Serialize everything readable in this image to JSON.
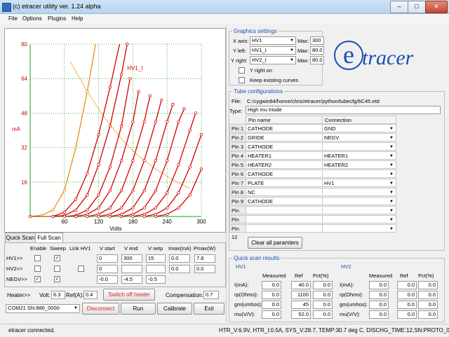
{
  "window": {
    "title": "(c) etracer utility ver. 1.24 alpha",
    "min": "–",
    "max": "□",
    "close": "✕"
  },
  "menu": [
    "File",
    "Options",
    "Plugins",
    "Help"
  ],
  "plot": {
    "ylabel": "mA",
    "xlabel": "Volts",
    "curve_label": "HV1_I",
    "yticks": [
      "80",
      "64",
      "48",
      "32",
      "16"
    ],
    "xticks": [
      "60",
      "120",
      "180",
      "240",
      "300"
    ],
    "colors": {
      "orange": "#e8920a",
      "red": "#d40000",
      "grid": "#17a517",
      "load": "#f0a030"
    }
  },
  "chart_data": {
    "type": "line",
    "xlabel": "Volts",
    "ylabel": "mA",
    "xlim": [
      0,
      300
    ],
    "ylim": [
      0,
      80
    ],
    "series": [
      {
        "x": [
          0,
          20,
          40,
          60,
          80,
          100,
          120
        ],
        "values": [
          0,
          0.5,
          3,
          12,
          32,
          58,
          88
        ]
      },
      {
        "x": [
          0,
          40,
          60,
          80,
          100,
          120,
          140,
          160
        ],
        "values": [
          0,
          0,
          2,
          8,
          20,
          38,
          60,
          84
        ]
      },
      {
        "x": [
          40,
          60,
          80,
          100,
          120,
          140,
          160,
          170
        ],
        "values": [
          0,
          0.5,
          3,
          10,
          24,
          42,
          66,
          80
        ]
      },
      {
        "x": [
          60,
          80,
          100,
          120,
          140,
          160,
          175
        ],
        "values": [
          0,
          0.5,
          3,
          10,
          23,
          42,
          64
        ]
      },
      {
        "x": [
          80,
          100,
          120,
          140,
          160,
          180,
          190
        ],
        "values": [
          0,
          1,
          4,
          12,
          26,
          44,
          58
        ]
      },
      {
        "x": [
          100,
          120,
          140,
          160,
          180,
          200,
          210
        ],
        "values": [
          0,
          1,
          4,
          12,
          26,
          44,
          56
        ]
      },
      {
        "x": [
          120,
          140,
          160,
          180,
          200,
          220,
          230
        ],
        "values": [
          0,
          1,
          4,
          12,
          26,
          44,
          54
        ]
      },
      {
        "x": [
          140,
          160,
          180,
          200,
          220,
          240,
          250
        ],
        "values": [
          0,
          1,
          4,
          12,
          26,
          44,
          52
        ]
      },
      {
        "x": [
          160,
          180,
          200,
          220,
          240,
          260,
          270
        ],
        "values": [
          0,
          1,
          4,
          12,
          26,
          44,
          50
        ]
      },
      {
        "x": [
          180,
          200,
          220,
          240,
          260,
          280,
          290
        ],
        "values": [
          0,
          1,
          4,
          11,
          24,
          40,
          48
        ]
      },
      {
        "x": [
          200,
          220,
          240,
          260,
          280,
          300
        ],
        "values": [
          0,
          1,
          4,
          11,
          23,
          38
        ]
      },
      {
        "x": [
          220,
          240,
          260,
          280,
          300
        ],
        "values": [
          0,
          1,
          4,
          10,
          22
        ]
      }
    ],
    "load_line": {
      "x": [
        70,
        100,
        130,
        160,
        190,
        220,
        250,
        280
      ],
      "values": [
        72,
        58,
        46,
        36,
        28,
        22,
        17,
        13
      ]
    }
  },
  "scan_tabs": [
    "Quick Scan",
    "Full Scan"
  ],
  "scan": {
    "headers": [
      "Enable",
      "Sweep",
      "Link HV1",
      "V start",
      "V end",
      "V setp",
      "Imax(mA)",
      "Pmax(W)"
    ],
    "rows": [
      {
        "name": "HV1>>",
        "vstart": "0",
        "vend": "300",
        "vstep": "15",
        "imax": "0.0",
        "pmax": "7.8"
      },
      {
        "name": "HV2>>",
        "vstart": "0",
        "vend": "",
        "vstep": "",
        "imax": "0.0",
        "pmax": "0.0"
      },
      {
        "name": "NEGV>>",
        "vstart": "-0.0",
        "vend": "-4.5",
        "vstep": "-0.5",
        "imax": "",
        "pmax": ""
      }
    ]
  },
  "heater": {
    "label": "Heater>>",
    "volt_label": "Volt:",
    "volt": "6.3",
    "ref_label": "Ref(A):",
    "ref": "0.4",
    "button": "Switch off heater",
    "comp_label": "Compensation:",
    "comp": "0.7"
  },
  "controls": {
    "port": "COM21 SN:886_0000",
    "disconnect": "Disconnect",
    "run": "Run",
    "calibrate": "Calibrate",
    "exit": "Exit"
  },
  "graphics": {
    "title": "Graphics settings",
    "xaxis_label": "X axis:",
    "xaxis": "HV1",
    "xmax_label": "Max:",
    "xmax": "300",
    "yleft_label": "Y left:",
    "yleft": "HV1_I",
    "ylmax_label": "Max:",
    "ylmax": "80.0",
    "yright_label": "Y right:",
    "yright": "HV2_I",
    "yrmax_label": "Max:",
    "yrmax": "80.0",
    "yright_on": "Y right on",
    "keep": "Keep existing curves"
  },
  "logo": {
    "e": "e",
    "tracer": "tracer"
  },
  "tube": {
    "title": "Tube configurations",
    "file_label": "File:",
    "file": "C:/cygwin64/home/chris/etracer/python/tubecfg/6C45.etd",
    "type_label": "Type:",
    "type": "High mu triode",
    "col_pin": "Pin name",
    "col_conn": "Connection",
    "pins": [
      {
        "row": "Pin 1",
        "name": "CATHODE",
        "conn": "GND"
      },
      {
        "row": "Pin 2",
        "name": "GRIDE",
        "conn": "NEGV"
      },
      {
        "row": "Pin 3",
        "name": "CATHODE",
        "conn": ""
      },
      {
        "row": "Pin 4",
        "name": "HEATER1",
        "conn": "HEATER1"
      },
      {
        "row": "Pin 5",
        "name": "HEATER2",
        "conn": "HEATER2"
      },
      {
        "row": "Pin 6",
        "name": "CATHODE",
        "conn": ""
      },
      {
        "row": "Pin 7",
        "name": "PLATE",
        "conn": "HV1"
      },
      {
        "row": "Pin 8",
        "name": "NC",
        "conn": ""
      },
      {
        "row": "Pin 9",
        "name": "CATHODE",
        "conn": ""
      },
      {
        "row": "Pin 10",
        "name": "",
        "conn": ""
      },
      {
        "row": "Pin 11",
        "name": "",
        "conn": ""
      },
      {
        "row": "Pin 12",
        "name": "",
        "conn": ""
      }
    ],
    "clear": "Clear all paramters"
  },
  "quick": {
    "title": "Quick scan results",
    "hv1": "HV1",
    "hv2": "HV2",
    "cols": [
      "Measured",
      "Ref",
      "Pct(%)"
    ],
    "rows": [
      {
        "label": "I(mA):",
        "m1": "0.0",
        "r1": "40.0",
        "p1": "0.0",
        "m2": "0.0",
        "r2": "0.0",
        "p2": "0.0"
      },
      {
        "label": "rp(Ohms):",
        "m1": "0.0",
        "r1": "1100",
        "p1": "0.0",
        "m2": "0.0",
        "r2": "0.0",
        "p2": "0.0"
      },
      {
        "label": "gm(umhos):",
        "m1": "0.0",
        "r1": "45",
        "p1": "0.0",
        "m2": "0.0",
        "r2": "0.0",
        "p2": "0.0"
      },
      {
        "label": "mu(V/V):",
        "m1": "0.0",
        "r1": "52.0",
        "p1": "0.0",
        "m2": "0.0",
        "r2": "0.0",
        "p2": "0.0"
      }
    ]
  },
  "status": {
    "left": "etracer connected.",
    "right": "HTR_V:6.9V, HTR_I:0.5A, SYS_V:28.7, TEMP:30.7 deg C, DISCHG_TIME:12,SN:PROTO_02"
  }
}
